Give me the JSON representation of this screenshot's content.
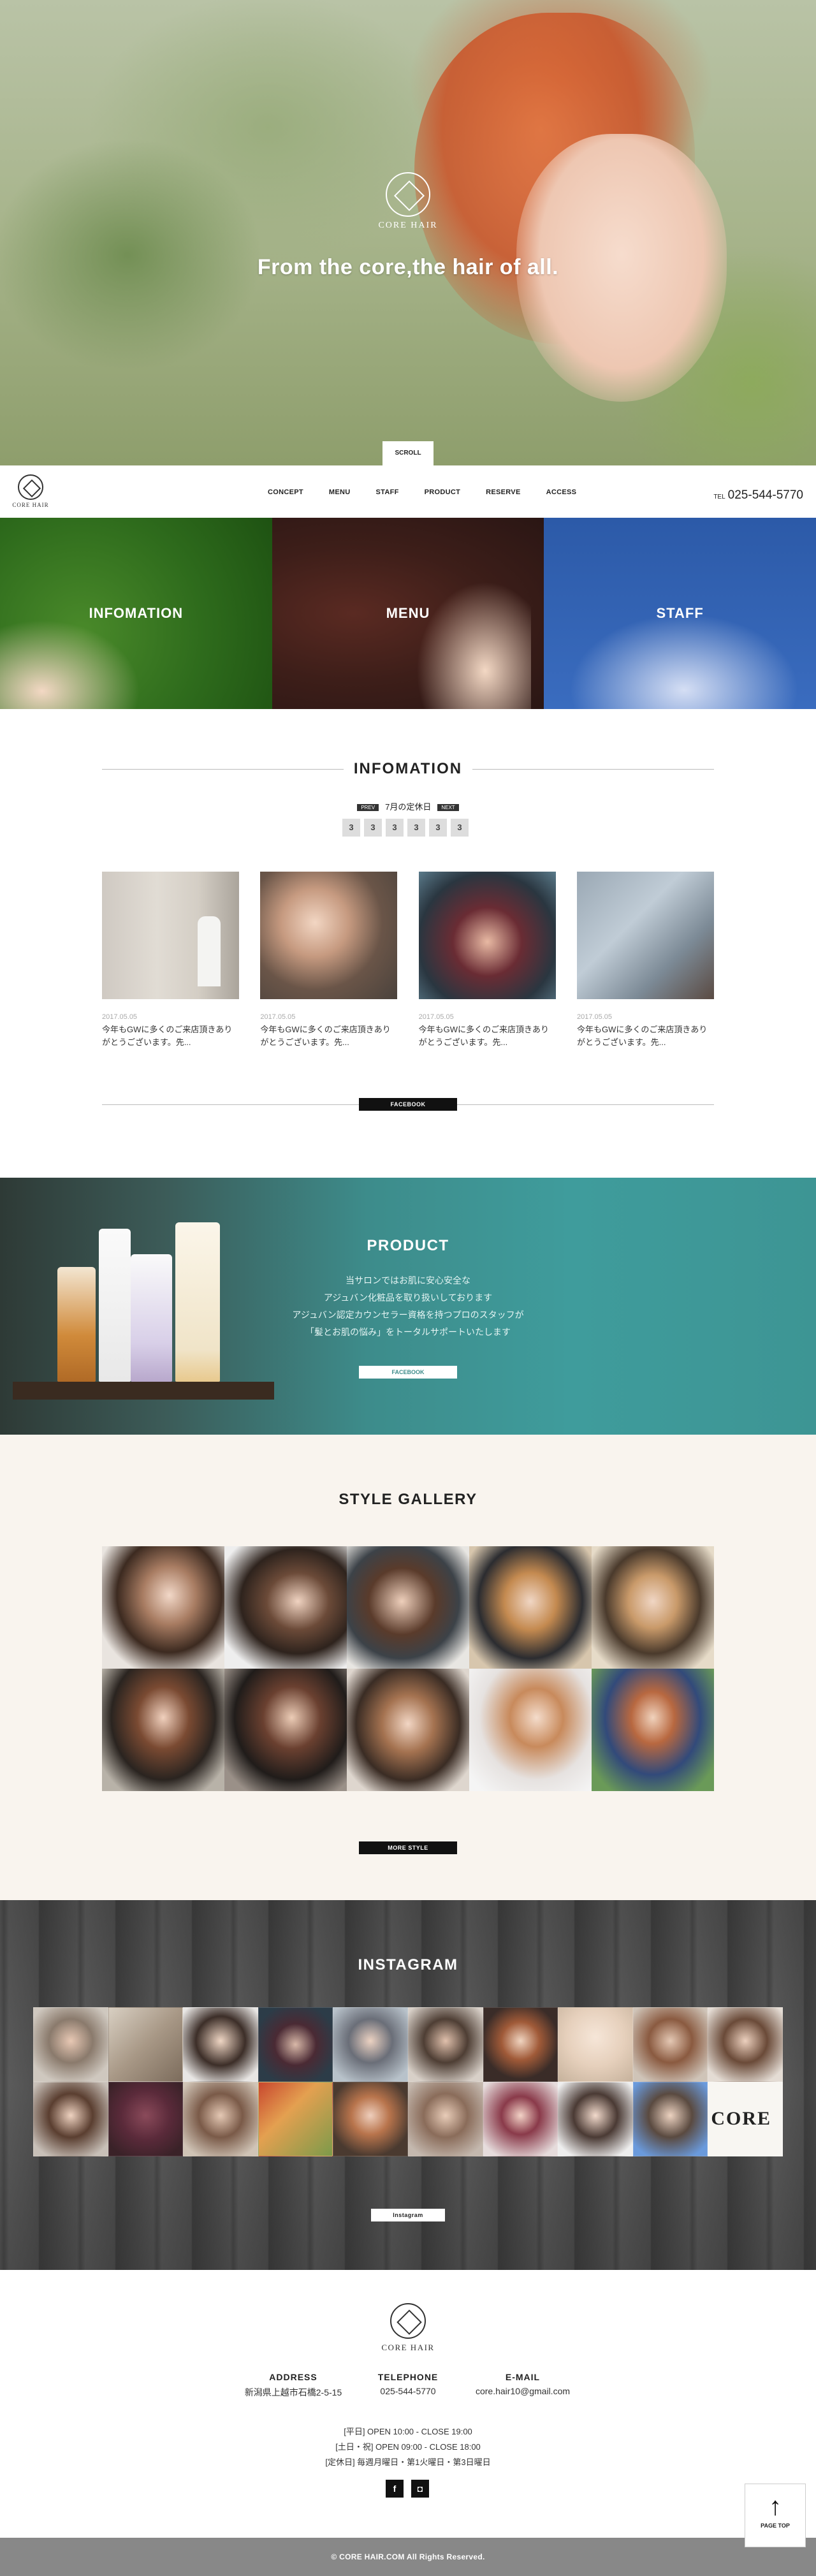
{
  "hero": {
    "logo_text": "CORE HAIR",
    "tagline": "From the core,the hair of all.",
    "scroll_label": "SCROLL"
  },
  "nav": {
    "logo_text": "CORE HAIR",
    "items": [
      "CONCEPT",
      "MENU",
      "STAFF",
      "PRODUCT",
      "RESERVE",
      "ACCESS"
    ],
    "tel_prefix": "TEL",
    "tel": "025-544-5770"
  },
  "tiles": [
    "INFOMATION",
    "MENU",
    "STAFF"
  ],
  "info": {
    "title": "INFOMATION",
    "prev_label": "PREV",
    "month_label": "7月の定休日",
    "next_label": "NEXT",
    "days": [
      "3",
      "3",
      "3",
      "3",
      "3",
      "3"
    ],
    "posts": [
      {
        "date": "2017.05.05",
        "text": "今年もGWに多くのご来店頂きありがとうございます。先..."
      },
      {
        "date": "2017.05.05",
        "text": "今年もGWに多くのご来店頂きありがとうございます。先..."
      },
      {
        "date": "2017.05.05",
        "text": "今年もGWに多くのご来店頂きありがとうございます。先..."
      },
      {
        "date": "2017.05.05",
        "text": "今年もGWに多くのご来店頂きありがとうございます。先..."
      }
    ],
    "facebook_button": "FACEBOOK"
  },
  "product": {
    "title": "PRODUCT",
    "lines": [
      "当サロンではお肌に安心安全な",
      "アジュバン化粧品を取り扱いしております",
      "アジュバン認定カウンセラー資格を持つプロのスタッフが",
      "「髪とお肌の悩み」をトータルサポートいたします"
    ],
    "facebook_button": "FACEBOOK"
  },
  "gallery": {
    "title": "STYLE GALLERY",
    "more_button": "MORE STYLE"
  },
  "instagram": {
    "title": "INSTAGRAM",
    "button": "Instagram",
    "core_tile_text": "CORE"
  },
  "footer": {
    "logo_text": "CORE HAIR",
    "address_label": "ADDRESS",
    "address": "新潟県上越市石橋2-5-15",
    "tel_label": "TELEPHONE",
    "tel": "025-544-5770",
    "email_label": "E-MAIL",
    "email": "core.hair10@gmail.com",
    "hours": [
      "[平日] OPEN 10:00 - CLOSE 19:00",
      "[土日・祝] OPEN 09:00 - CLOSE 18:00",
      "[定休日] 毎週月曜日・第1火曜日・第3日曜日"
    ],
    "facebook_glyph": "f",
    "instagram_glyph": "◘",
    "copyright": "© CORE HAIR.COM All Rights Reserved."
  },
  "pagetop": {
    "arrow": "↑",
    "label": "PAGE TOP"
  }
}
